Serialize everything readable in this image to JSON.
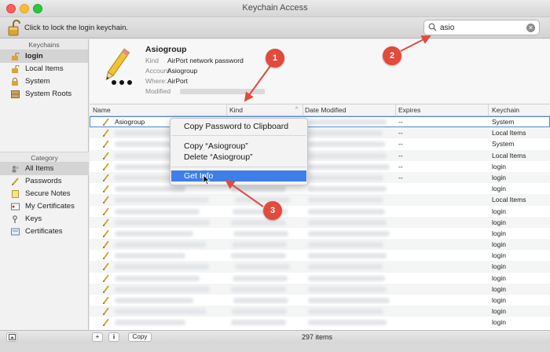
{
  "window": {
    "title": "Keychain Access"
  },
  "toolbar": {
    "lock_text": "Click to lock the login keychain."
  },
  "search": {
    "value": "asio"
  },
  "sidebar": {
    "keychains_header": "Keychains",
    "keychains": [
      {
        "label": "login"
      },
      {
        "label": "Local Items"
      },
      {
        "label": "System"
      },
      {
        "label": "System Roots"
      }
    ],
    "category_header": "Category",
    "categories": [
      {
        "label": "All Items"
      },
      {
        "label": "Passwords"
      },
      {
        "label": "Secure Notes"
      },
      {
        "label": "My Certificates"
      },
      {
        "label": "Keys"
      },
      {
        "label": "Certificates"
      }
    ]
  },
  "detail": {
    "name": "Asiogroup",
    "kind_label": "Kind",
    "kind_value": "AirPort network password",
    "account_label": "Account",
    "account_value": "Asiogroup",
    "where_label": "Where:",
    "where_value": "AirPort",
    "modified_label": "Modified"
  },
  "table": {
    "columns": {
      "name": "Name",
      "kind": "Kind",
      "date_modified": "Date Modified",
      "expires": "Expires",
      "keychain": "Keychain"
    },
    "rows": [
      {
        "name": "Asiogroup",
        "expires": "--",
        "keychain": "System"
      },
      {
        "name": "",
        "expires": "--",
        "keychain": "Local Items"
      },
      {
        "name": "",
        "expires": "--",
        "keychain": "System"
      },
      {
        "name": "",
        "expires": "--",
        "keychain": "Local Items"
      },
      {
        "name": "",
        "expires": "--",
        "keychain": "login"
      },
      {
        "name": "",
        "expires": "--",
        "keychain": "login"
      },
      {
        "name": "",
        "expires": "",
        "keychain": "login"
      },
      {
        "name": "",
        "expires": "",
        "keychain": "Local Items"
      },
      {
        "name": "",
        "expires": "",
        "keychain": "login"
      },
      {
        "name": "",
        "expires": "",
        "keychain": "login"
      },
      {
        "name": "",
        "expires": "",
        "keychain": "login"
      },
      {
        "name": "",
        "expires": "",
        "keychain": "login"
      },
      {
        "name": "",
        "expires": "",
        "keychain": "login"
      },
      {
        "name": "",
        "expires": "",
        "keychain": "login"
      },
      {
        "name": "",
        "expires": "",
        "keychain": "login"
      },
      {
        "name": "",
        "expires": "",
        "keychain": "login"
      },
      {
        "name": "",
        "expires": "",
        "keychain": "login"
      },
      {
        "name": "",
        "expires": "",
        "keychain": "login"
      },
      {
        "name": "",
        "expires": "",
        "keychain": "login"
      }
    ]
  },
  "context_menu": {
    "copy_password": "Copy Password to Clipboard",
    "copy_item": "Copy “Asiogroup”",
    "delete_item": "Delete “Asiogroup”",
    "get_info": "Get Info"
  },
  "bottom": {
    "add_label": "+",
    "info_label": "i",
    "copy_label": "Copy",
    "item_count": "297 items"
  },
  "annotations": {
    "step1": "1",
    "step2": "2",
    "step3": "3"
  },
  "colors": {
    "accent": "#3d7ee9",
    "annotation": "#e24a3c",
    "selection_outline": "#4d88db"
  }
}
